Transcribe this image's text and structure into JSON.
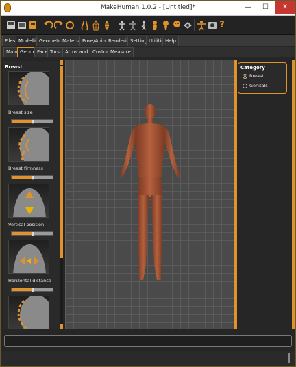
{
  "window": {
    "title": "MakeHuman 1.0.2 - [Untitled]*",
    "minimize": "—",
    "maximize": "☐",
    "close": "✕"
  },
  "toolbar": {
    "icons": [
      "save-icon",
      "load-icon",
      "export-icon",
      "undo-icon",
      "redo-icon",
      "reset-icon",
      "smooth-icon",
      "wireframe-icon",
      "subdivide-icon",
      "front-view-icon",
      "back-view-icon",
      "left-view-icon",
      "right-view-icon",
      "top-view-icon",
      "bottom-view-icon",
      "reset-camera-icon",
      "skeleton-icon",
      "pose-icon",
      "screenshot-icon",
      "help-icon"
    ]
  },
  "main_tabs": [
    {
      "label": "Files",
      "active": false
    },
    {
      "label": "Modelling",
      "active": true
    },
    {
      "label": "Geometries",
      "active": false
    },
    {
      "label": "Materials",
      "active": false
    },
    {
      "label": "Pose/Animate",
      "active": false
    },
    {
      "label": "Rendering",
      "active": false
    },
    {
      "label": "Settings",
      "active": false
    },
    {
      "label": "Utilities",
      "active": false
    },
    {
      "label": "Help",
      "active": false
    }
  ],
  "sub_tabs": [
    {
      "label": "Main",
      "active": false
    },
    {
      "label": "Gender",
      "active": true
    },
    {
      "label": "Face",
      "active": false
    },
    {
      "label": "Torso",
      "active": false
    },
    {
      "label": "Arms and Legs",
      "active": false
    },
    {
      "label": "Custom",
      "active": false
    },
    {
      "label": "Measure",
      "active": false
    }
  ],
  "left_panel": {
    "title": "Breast",
    "sliders": [
      {
        "label": "Breast size",
        "value": 0.5
      },
      {
        "label": "Breast firmness",
        "value": 0.5
      },
      {
        "label": "Vertical position",
        "value": 0.5
      },
      {
        "label": "Horizontal distance",
        "value": 0.5
      }
    ]
  },
  "right_panel": {
    "title": "Category",
    "options": [
      {
        "label": "Breast",
        "selected": true
      },
      {
        "label": "Genitals",
        "selected": false
      }
    ]
  },
  "colors": {
    "accent": "#e0932a",
    "skin": "#a9583a",
    "viewport_bg": "#4a4a4a"
  }
}
